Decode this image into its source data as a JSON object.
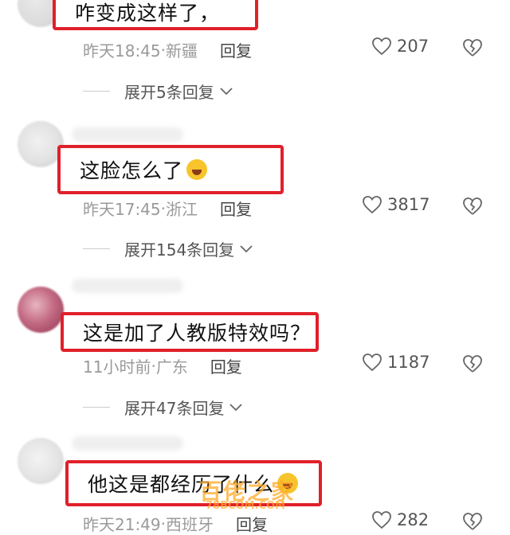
{
  "comments": [
    {
      "text": "咋变成这样了，",
      "time": "昨天18:45",
      "location": "新疆",
      "reply_label": "回复",
      "likes": "207",
      "expand_label": "展开5条回复"
    },
    {
      "text": "这脸怎么了",
      "emoji": "laughing-crying-emoji",
      "time": "昨天17:45",
      "location": "浙江",
      "reply_label": "回复",
      "likes": "3817",
      "expand_label": "展开154条回复"
    },
    {
      "text": "这是加了人教版特效吗？",
      "time": "11小时前",
      "location": "广东",
      "reply_label": "回复",
      "likes": "1187",
      "expand_label": "展开47条回复"
    },
    {
      "text": "他这是都经历了什么",
      "emoji": "dizzy-face-emoji",
      "time": "昨天21:49",
      "location": "西班牙",
      "reply_label": "回复",
      "likes": "282"
    }
  ],
  "separator": " · ",
  "watermark": {
    "text": "百佬之家",
    "sub": "78BCOM.COM"
  },
  "colors": {
    "highlight_border": "#e0202a",
    "meta_text": "#9a9a9a",
    "watermark": "#ffaa28"
  }
}
